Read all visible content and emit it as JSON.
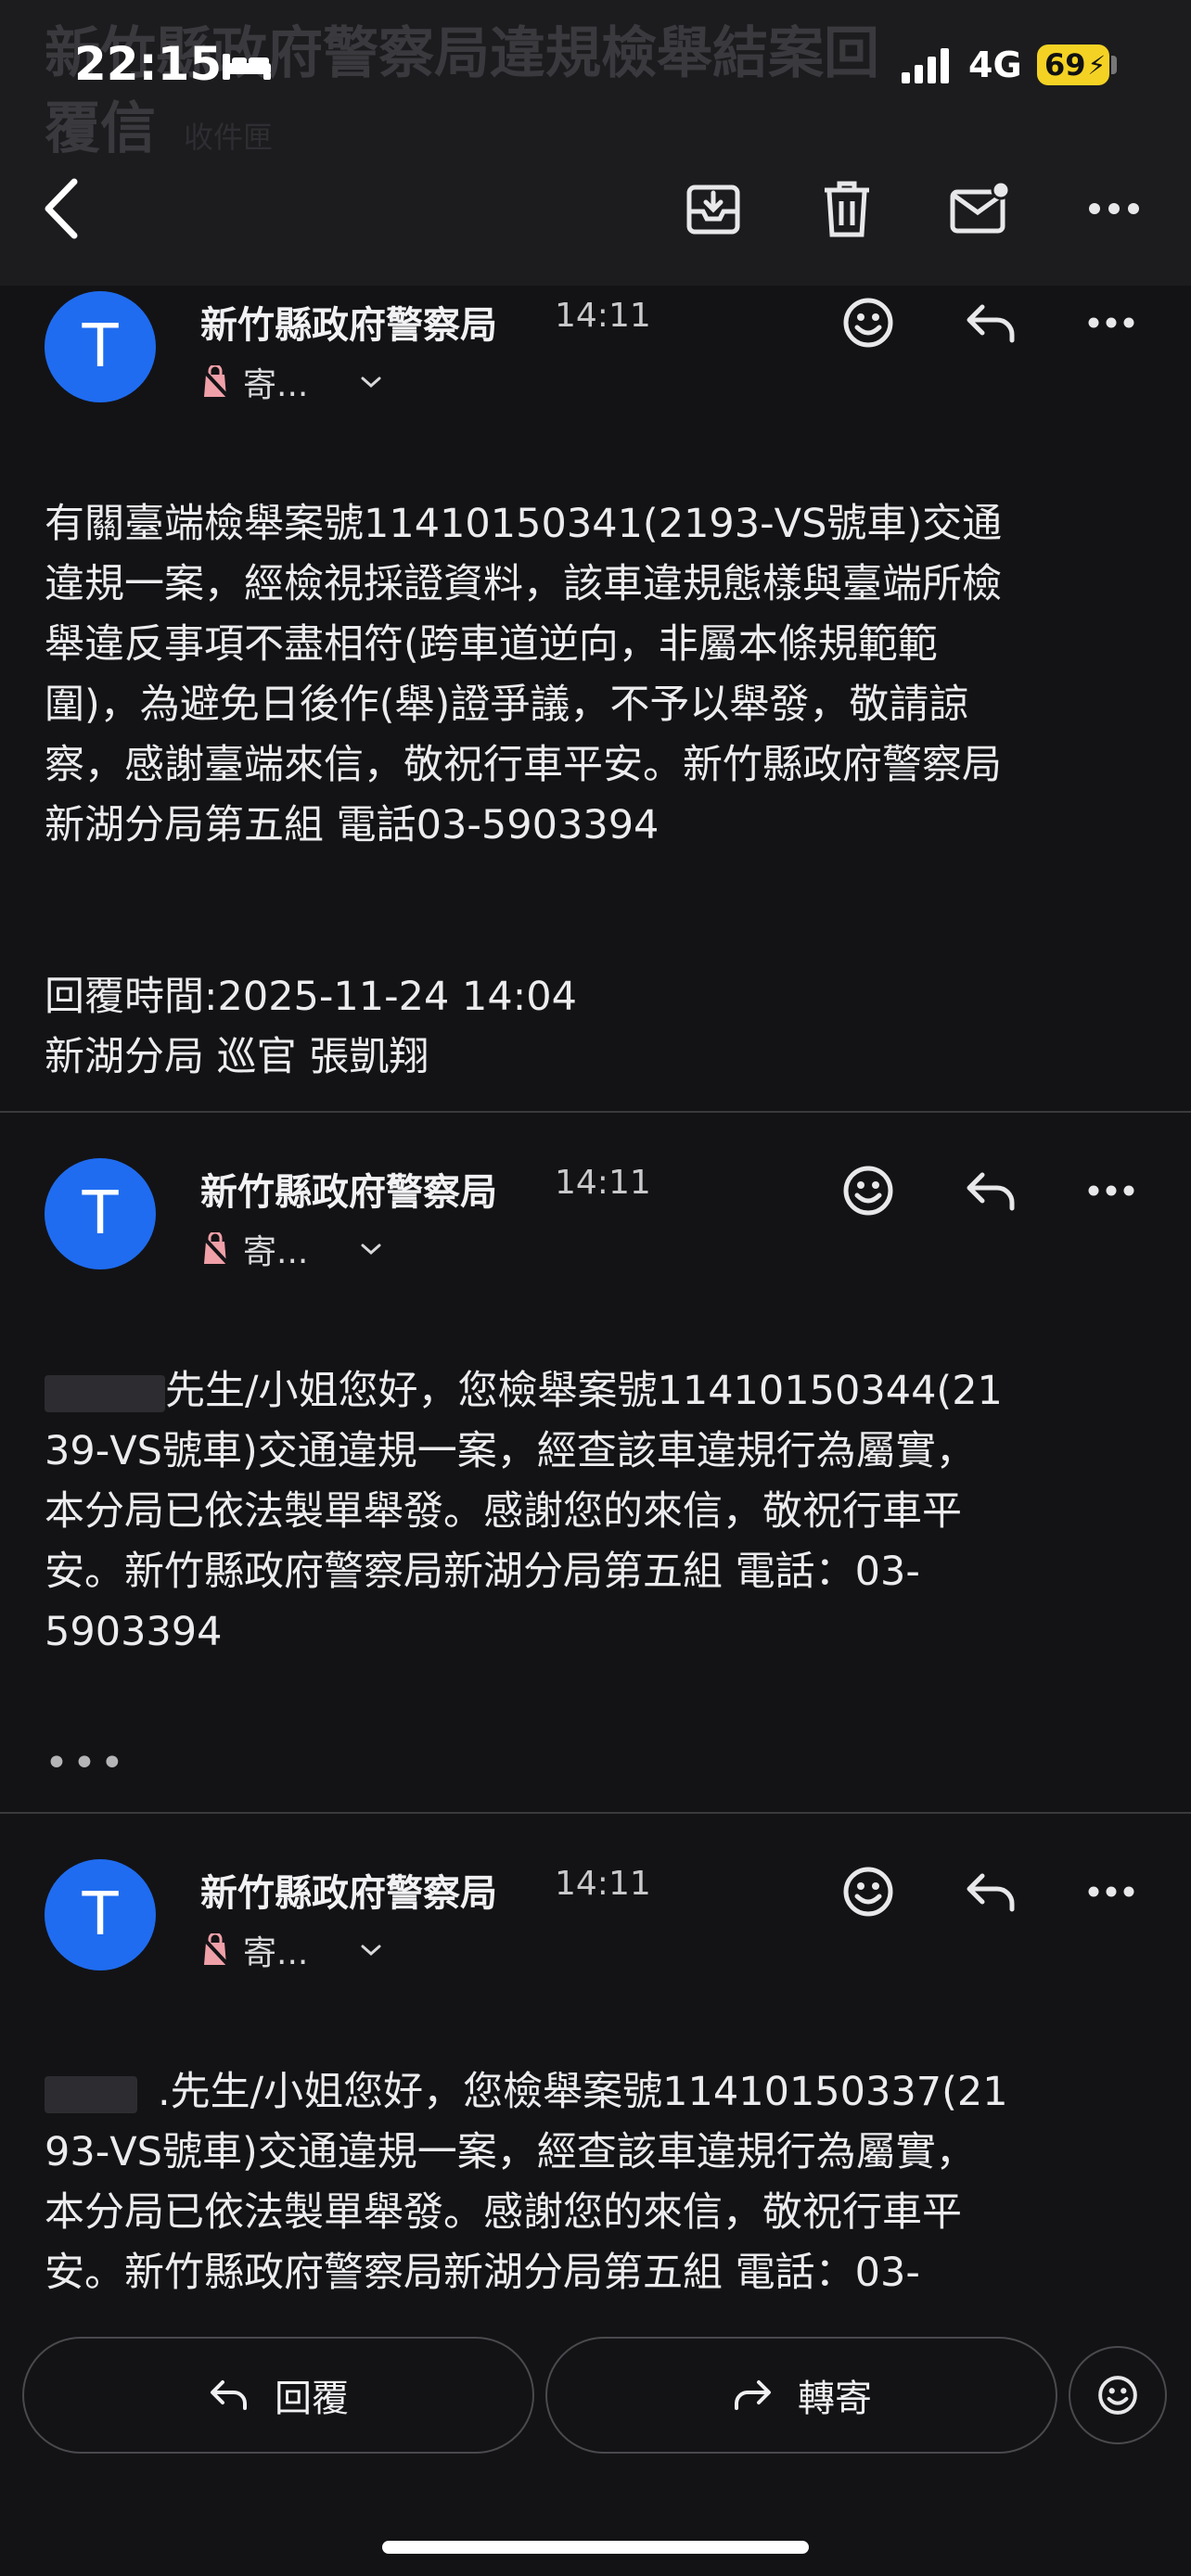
{
  "status_bar": {
    "time": "22:15",
    "network": "4G",
    "battery": "69"
  },
  "header": {
    "subject_line1": "新竹縣政府警察局違規檢舉結案回",
    "subject_line2": "覆信",
    "subject_tag": "收件匣",
    "icons": [
      "back-icon",
      "archive-icon",
      "trash-icon",
      "mark-unread-icon",
      "more-icon"
    ]
  },
  "messages": [
    {
      "avatar": "T",
      "sender": "新竹縣政府警察局",
      "time": "14:11",
      "recipient": "寄...",
      "body": "有關臺端檢舉案號11410150341(2193-VS號車)交通\n違規一案，經檢視採證資料，該車違規態樣與臺端所檢\n舉違反事項不盡相符(跨車道逆向，非屬本條規範範\n圍)，為避免日後作(舉)證爭議，不予以舉發，敬請諒\n察，感謝臺端來信，敬祝行車平安。新竹縣政府警察局\n新湖分局第五組 電話03-5903394",
      "reply_time": "回覆時間:2025-11-24 14:04",
      "officer": "新湖分局 巡官 張凱翔"
    },
    {
      "avatar": "T",
      "sender": "新竹縣政府警察局",
      "time": "14:11",
      "recipient": "寄...",
      "body": "先生/小姐您好，您檢舉案號11410150344(21\n39-VS號車)交通違規一案，經查該車違規行為屬實，\n本分局已依法製單舉發。感謝您的來信，敬祝行車平\n安。新竹縣政府警察局新湖分局第五組 電話：03-\n5903394",
      "more": "•••"
    },
    {
      "avatar": "T",
      "sender": "新竹縣政府警察局",
      "time": "14:11",
      "recipient": "寄...",
      "body": ".先生/小姐您好，您檢舉案號11410150337(21\n93-VS號車)交通違規一案，經查該車違規行為屬實，\n本分局已依法製單舉發。感謝您的來信，敬祝行車平\n安。新竹縣政府警察局新湖分局第五組 電話：03-"
    }
  ],
  "bottom": {
    "reply": "回覆",
    "forward": "轉寄"
  }
}
